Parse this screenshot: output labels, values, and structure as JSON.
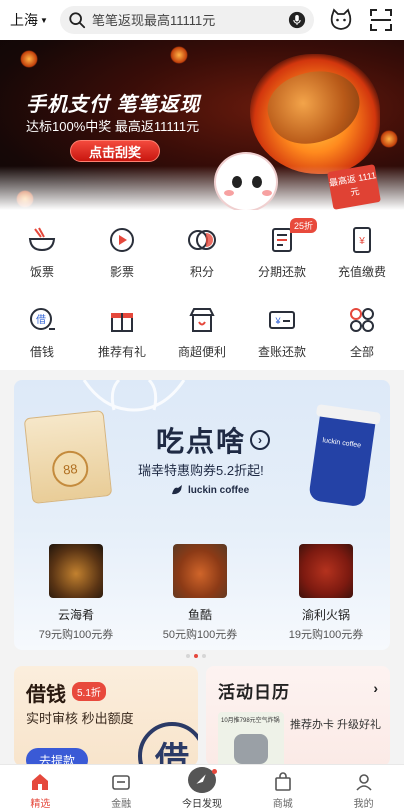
{
  "header": {
    "city": "上海",
    "search_placeholder": "笔笔返现最高11111元"
  },
  "banner": {
    "title": "手机支付 笔笔返现",
    "subtitle": "达标100%中奖 最高返11111元",
    "button": "点击刮奖",
    "tag": "最高返 1111元"
  },
  "services": [
    {
      "label": "饭票",
      "icon": "bowl-icon"
    },
    {
      "label": "影票",
      "icon": "play-icon"
    },
    {
      "label": "积分",
      "icon": "points-icon"
    },
    {
      "label": "分期还款",
      "icon": "installment-icon",
      "badge": "25折"
    },
    {
      "label": "充值缴费",
      "icon": "phone-recharge-icon"
    },
    {
      "label": "借钱",
      "icon": "loan-icon"
    },
    {
      "label": "推荐有礼",
      "icon": "gift-icon"
    },
    {
      "label": "商超便利",
      "icon": "store-icon"
    },
    {
      "label": "查账还款",
      "icon": "bill-icon"
    },
    {
      "label": "全部",
      "icon": "all-apps-icon"
    }
  ],
  "promo": {
    "title": "吃点啥",
    "arrow": "›",
    "subtitle": "瑞幸特惠购券5.2折起!",
    "brand": "luckin coffee",
    "coupon": "88",
    "cup_text": "luckin coffee",
    "items": [
      {
        "name": "云海肴",
        "price": "79元购100元券"
      },
      {
        "name": "鱼酷",
        "price": "50元购100元券"
      },
      {
        "name": "渝利火锅",
        "price": "19元购100元券"
      }
    ]
  },
  "card_loan": {
    "title": "借钱",
    "badge": "5.1折",
    "subtitle": "实时审核 秒出额度",
    "button": "去提款",
    "seal": "借"
  },
  "card_activity": {
    "title": "活动日历",
    "chevron": "›",
    "subtitle": "推荐办卡 升级好礼",
    "thumb_text": "10月推798元空气炸锅"
  },
  "tabbar": [
    {
      "label": "精选",
      "active": true
    },
    {
      "label": "金融",
      "active": false
    },
    {
      "label": "今日发现",
      "active": false
    },
    {
      "label": "商城",
      "active": false
    },
    {
      "label": "我的",
      "active": false
    }
  ],
  "colors": {
    "accent": "#e5483c",
    "promo_bg": "#dde9f8",
    "loan_bg": "#fbeedd"
  }
}
